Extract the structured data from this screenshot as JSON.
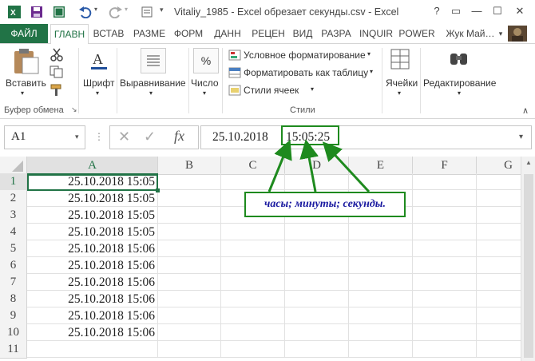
{
  "window": {
    "title": "Vitaliy_1985 - Excel обрезает секунды.csv - Excel",
    "help": "?",
    "ribbon_display": "▭",
    "minimize": "—",
    "maximize": "☐",
    "close": "✕"
  },
  "tabs": [
    "ФАЙЛ",
    "ГЛАВН",
    "ВСТАВ",
    "РАЗМЕ",
    "ФОРМ",
    "ДАНН",
    "РЕЦЕН",
    "ВИД",
    "РАЗРА",
    "INQUIR",
    "POWER"
  ],
  "user": "Жук Май…",
  "ribbon": {
    "paste": "Вставить",
    "clipboard_group": "Буфер обмена",
    "font": "Шрифт",
    "alignment": "Выравнивание",
    "number": "Число",
    "number_symbol": "%",
    "conditional": "Условное форматирование",
    "format_table": "Форматировать как таблицу",
    "cell_styles": "Стили ячеек",
    "styles_group": "Стили",
    "cells": "Ячейки",
    "editing": "Редактирование"
  },
  "formula_bar": {
    "name_box": "A1",
    "fx": "fx",
    "date_part": "25.10.2018",
    "time_part": "15:05:25"
  },
  "annotation": "часы; минуты; секунды.",
  "columns": [
    "A",
    "B",
    "C",
    "D",
    "E",
    "F",
    "G"
  ],
  "rows": [
    {
      "num": "1",
      "a": "25.10.2018 15:05"
    },
    {
      "num": "2",
      "a": "25.10.2018 15:05"
    },
    {
      "num": "3",
      "a": "25.10.2018 15:05"
    },
    {
      "num": "4",
      "a": "25.10.2018 15:05"
    },
    {
      "num": "5",
      "a": "25.10.2018 15:06"
    },
    {
      "num": "6",
      "a": "25.10.2018 15:06"
    },
    {
      "num": "7",
      "a": "25.10.2018 15:06"
    },
    {
      "num": "8",
      "a": "25.10.2018 15:06"
    },
    {
      "num": "9",
      "a": "25.10.2018 15:06"
    },
    {
      "num": "10",
      "a": "25.10.2018 15:06"
    },
    {
      "num": "11",
      "a": ""
    }
  ],
  "colors": {
    "excel_green": "#217346",
    "annotation_green": "#1e8a1e",
    "annotation_text": "#1a1aa0"
  }
}
